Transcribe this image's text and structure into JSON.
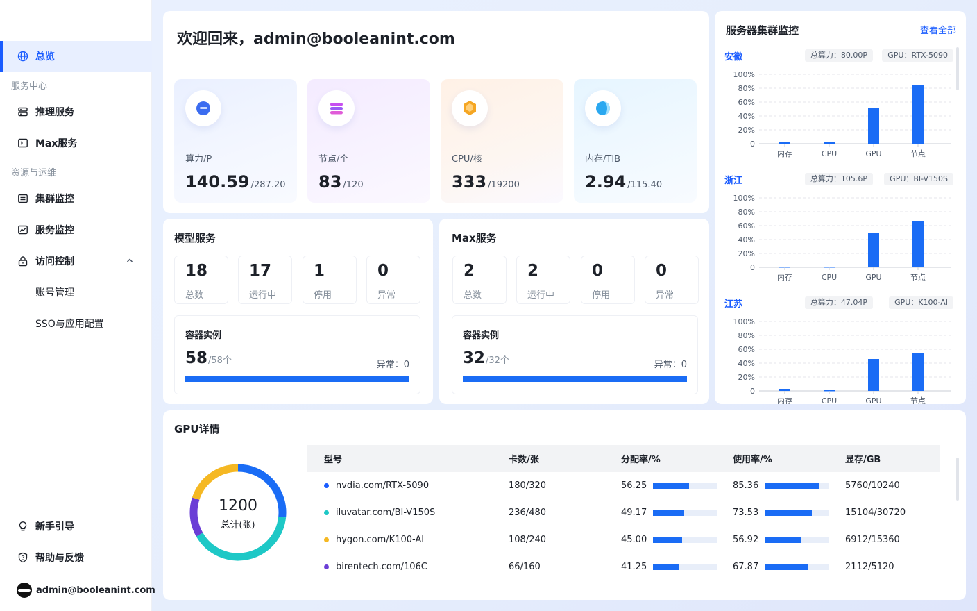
{
  "sidebar": {
    "active": "总览",
    "groups": [
      "服务中心",
      "资源与运维"
    ],
    "items": [
      {
        "label": "总览",
        "icon": "globe-icon"
      },
      {
        "label": "推理服务",
        "icon": "server-icon"
      },
      {
        "label": "Max服务",
        "icon": "terminal-icon"
      },
      {
        "label": "集群监控",
        "icon": "list-icon"
      },
      {
        "label": "服务监控",
        "icon": "chart-icon"
      },
      {
        "label": "访问控制",
        "icon": "lock-icon"
      },
      {
        "label": "账号管理",
        "icon": ""
      },
      {
        "label": "SSO与应用配置",
        "icon": ""
      }
    ],
    "bottom": [
      {
        "label": "新手引导",
        "icon": "bulb-icon"
      },
      {
        "label": "帮助与反馈",
        "icon": "shield-question-icon"
      }
    ],
    "user": "admin@booleanint.com"
  },
  "welcome": {
    "title": "欢迎回来，admin@booleanint.com",
    "stats": [
      {
        "label": "算力/P",
        "value": "140.59",
        "total": "/287.20",
        "icon": "compute-icon",
        "color": "#3b6cf0"
      },
      {
        "label": "节点/个",
        "value": "83",
        "total": "/120",
        "icon": "node-icon",
        "color": "#b24ff0"
      },
      {
        "label": "CPU/核",
        "value": "333",
        "total": "/19200",
        "icon": "cpu-icon",
        "color": "#f59a23"
      },
      {
        "label": "内存/TIB",
        "value": "2.94",
        "total": "/115.40",
        "icon": "memory-icon",
        "color": "#2aa8f0"
      }
    ]
  },
  "model_service": {
    "title": "模型服务",
    "stats": [
      {
        "value": "18",
        "label": "总数"
      },
      {
        "value": "17",
        "label": "运行中"
      },
      {
        "value": "1",
        "label": "停用"
      },
      {
        "value": "0",
        "label": "异常"
      }
    ],
    "container": {
      "title": "容器实例",
      "value": "58",
      "total": "/58个",
      "error": "异常：0",
      "ratio": 1.0
    }
  },
  "max_service": {
    "title": "Max服务",
    "stats": [
      {
        "value": "2",
        "label": "总数"
      },
      {
        "value": "2",
        "label": "运行中"
      },
      {
        "value": "0",
        "label": "停用"
      },
      {
        "value": "0",
        "label": "异常"
      }
    ],
    "container": {
      "title": "容器实例",
      "value": "32",
      "total": "/32个",
      "error": "异常：0",
      "ratio": 1.0
    }
  },
  "cluster": {
    "title": "服务器集群监控",
    "view_all": "查看全部",
    "regions": [
      {
        "name": "安徽",
        "compute": "总算力：80.00P",
        "gpu": "GPU：RTX-5090"
      },
      {
        "name": "浙江",
        "compute": "总算力：105.6P",
        "gpu": "GPU：BI-V150S"
      },
      {
        "name": "江苏",
        "compute": "总算力：47.04P",
        "gpu": "GPU：K100-AI"
      }
    ]
  },
  "chart_data": [
    {
      "type": "bar",
      "categories": [
        "内存",
        "CPU",
        "GPU",
        "节点"
      ],
      "values": [
        2,
        2,
        52,
        84
      ],
      "yticks": [
        "0",
        "20%",
        "40%",
        "60%",
        "80%",
        "100%"
      ],
      "ylim": [
        0,
        100
      ],
      "grid": true
    },
    {
      "type": "bar",
      "categories": [
        "内存",
        "CPU",
        "GPU",
        "节点"
      ],
      "values": [
        1,
        1,
        49,
        67
      ],
      "yticks": [
        "0",
        "20%",
        "40%",
        "60%",
        "80%",
        "100%"
      ],
      "ylim": [
        0,
        100
      ],
      "grid": true
    },
    {
      "type": "bar",
      "categories": [
        "内存",
        "CPU",
        "GPU",
        "节点"
      ],
      "values": [
        3,
        1,
        46,
        54
      ],
      "yticks": [
        "0",
        "20%",
        "40%",
        "60%",
        "80%",
        "100%"
      ],
      "ylim": [
        0,
        100
      ],
      "grid": true
    },
    {
      "type": "pie",
      "title": "GPU详情",
      "center_value": "1200",
      "center_label": "总计(张)",
      "categories": [
        "nvdia.com/RTX-5090",
        "iluvatar.com/BI-V150S",
        "hygon.com/K100-AI",
        "birentech.com/106C"
      ],
      "values": [
        320,
        480,
        240,
        160
      ],
      "colors": [
        "#1a6cf5",
        "#1ec8c6",
        "#f5b823",
        "#6b3ed6"
      ]
    }
  ],
  "gpu": {
    "title": "GPU详情",
    "columns": [
      "型号",
      "卡数/张",
      "分配率/%",
      "使用率/%",
      "显存/GB"
    ],
    "rows": [
      {
        "model": "nvdia.com/RTX-5090",
        "color": "#1a5cff",
        "cards": "180/320",
        "alloc": "56.25",
        "alloc_frac": 0.5625,
        "usage": "85.36",
        "usage_frac": 0.8536,
        "mem": "5760/10240"
      },
      {
        "model": "iluvatar.com/BI-V150S",
        "color": "#1ec8c6",
        "cards": "236/480",
        "alloc": "49.17",
        "alloc_frac": 0.4917,
        "usage": "73.53",
        "usage_frac": 0.7353,
        "mem": "15104/30720"
      },
      {
        "model": "hygon.com/K100-AI",
        "color": "#f5b823",
        "cards": "108/240",
        "alloc": "45.00",
        "alloc_frac": 0.45,
        "usage": "56.92",
        "usage_frac": 0.5692,
        "mem": "6912/15360"
      },
      {
        "model": "birentech.com/106C",
        "color": "#6b3ed6",
        "cards": "66/160",
        "alloc": "41.25",
        "alloc_frac": 0.4125,
        "usage": "67.87",
        "usage_frac": 0.6787,
        "mem": "2112/5120"
      }
    ]
  }
}
